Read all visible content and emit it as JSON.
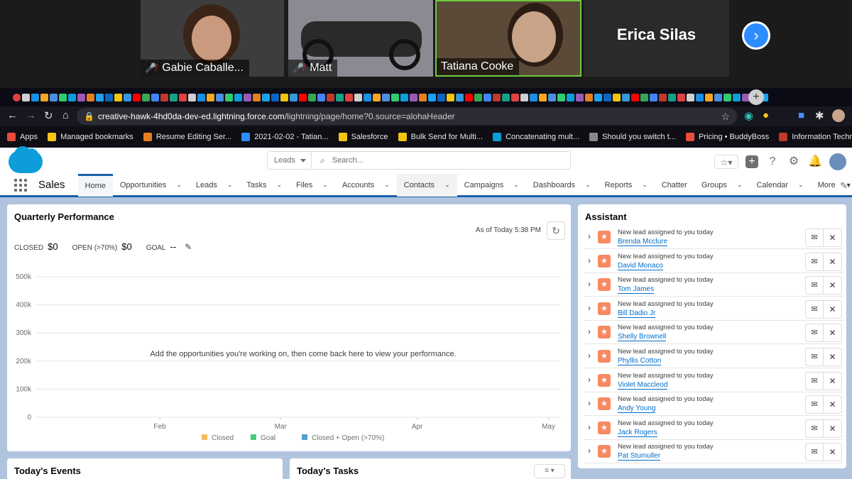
{
  "zoom": {
    "participants": [
      {
        "name": "Gabie Caballe..."
      },
      {
        "name": "Matt"
      },
      {
        "name": "Tatiana Cooke"
      },
      {
        "name": "Erica Silas"
      }
    ]
  },
  "browser": {
    "url_host": "creative-hawk-4hd0da-dev-ed.lightning.force.com",
    "url_path": "/lightning/page/home?0.source=alohaHeader",
    "bookmarks": [
      {
        "label": "Apps",
        "color": "#e74c3c"
      },
      {
        "label": "Managed bookmarks",
        "color": "#f5c518"
      },
      {
        "label": "Resume Editing Ser...",
        "color": "#e67e22"
      },
      {
        "label": "2021-02-02 - Tatian...",
        "color": "#2d8cff"
      },
      {
        "label": "Salesforce",
        "color": "#f5c518"
      },
      {
        "label": "Bulk Send for Multi...",
        "color": "#f1c40f"
      },
      {
        "label": "Concatenating mult...",
        "color": "#0d9dda"
      },
      {
        "label": "Should you switch t...",
        "color": "#888888"
      },
      {
        "label": "Pricing • BuddyBoss",
        "color": "#e74c3c"
      },
      {
        "label": "Information Techno...",
        "color": "#c0392b"
      }
    ]
  },
  "sf": {
    "search_scope": "Leads",
    "search_placeholder": "Search...",
    "app_name": "Sales",
    "nav": [
      {
        "label": "Home"
      },
      {
        "label": "Opportunities"
      },
      {
        "label": "Leads"
      },
      {
        "label": "Tasks"
      },
      {
        "label": "Files"
      },
      {
        "label": "Accounts"
      },
      {
        "label": "Contacts"
      },
      {
        "label": "Campaigns"
      },
      {
        "label": "Dashboards"
      },
      {
        "label": "Reports"
      },
      {
        "label": "Chatter"
      },
      {
        "label": "Groups"
      },
      {
        "label": "Calendar"
      },
      {
        "label": "More"
      }
    ],
    "perf": {
      "title": "Quarterly Performance",
      "as_of": "As of Today 5:38 PM",
      "closed_label": "CLOSED",
      "closed_value": "$0",
      "open_label": "OPEN (>70%)",
      "open_value": "$0",
      "goal_label": "GOAL",
      "goal_value": "--",
      "empty_message": "Add the opportunities you're working on, then come back here to view your performance."
    },
    "assistant": {
      "title": "Assistant",
      "message": "New lead assigned to you today",
      "leads": [
        "Brenda Mcclure",
        "David Monaco",
        "Tom James",
        "Bill Dadio Jr",
        "Shelly Brownell",
        "Phyllis Cotton",
        "Violet Maccleod",
        "Andy Young",
        "Jack Rogers",
        "Pat Stumuller"
      ]
    },
    "events_title": "Today's Events",
    "tasks_title": "Today's Tasks"
  },
  "chart_data": {
    "type": "line",
    "x": [
      "Feb",
      "Mar",
      "Apr",
      "May"
    ],
    "y_ticks": [
      "500k",
      "400k",
      "300k",
      "200k",
      "100k",
      "0"
    ],
    "ylim": [
      0,
      500000
    ],
    "series": [
      {
        "name": "Closed",
        "color": "#f4bc5f",
        "values": []
      },
      {
        "name": "Goal",
        "color": "#4bca81",
        "values": []
      },
      {
        "name": "Closed + Open (>70%)",
        "color": "#54a0cd",
        "values": []
      }
    ]
  }
}
